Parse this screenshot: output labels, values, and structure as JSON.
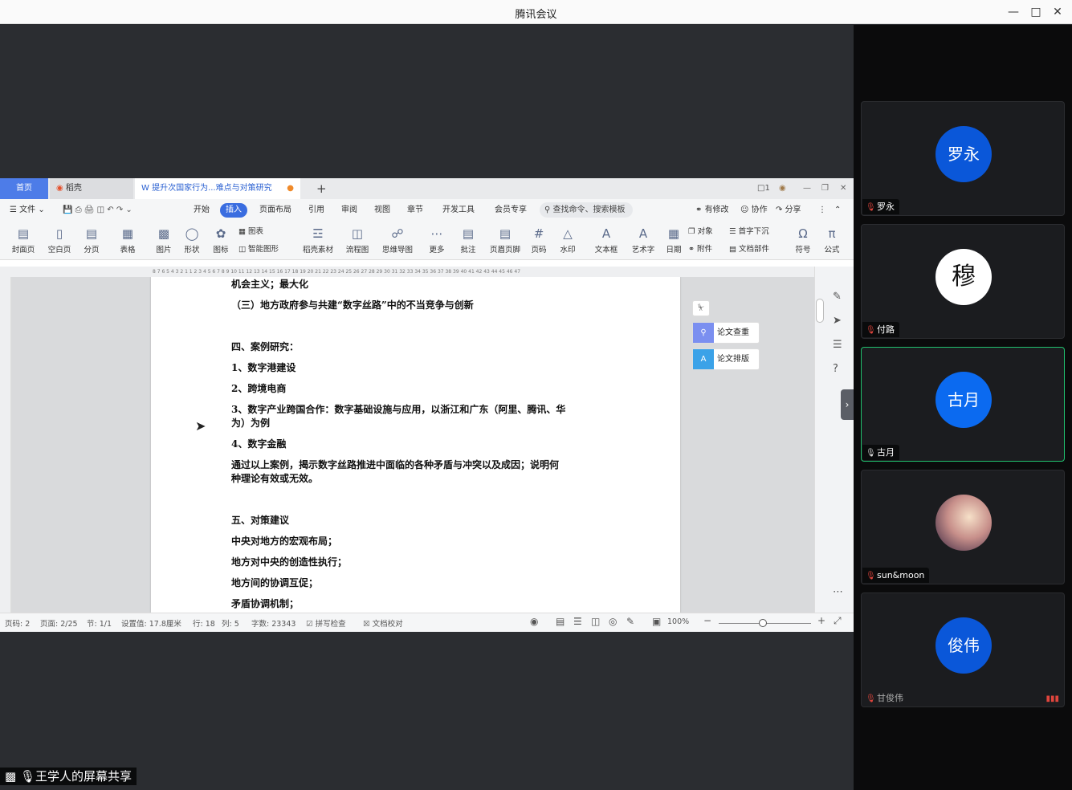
{
  "window": {
    "title": "腾讯会议"
  },
  "participants": [
    {
      "name": "罗永",
      "avatar_text": "罗永",
      "mic": "muted",
      "active": false
    },
    {
      "name": "付路",
      "avatar_text": "",
      "mic": "muted",
      "active": false
    },
    {
      "name": "古月",
      "avatar_text": "古月",
      "mic": "on",
      "active": true
    },
    {
      "name": "sun&moon",
      "avatar_text": "",
      "mic": "muted",
      "active": false
    },
    {
      "name": "甘俊伟",
      "avatar_text": "俊伟",
      "mic": "muted",
      "active": false
    }
  ],
  "share_label": "王学人的屏幕共享",
  "wps": {
    "tabs": {
      "home": "首页",
      "daoke": "稻壳",
      "doc": "提升次国家行为...难点与对策研究"
    },
    "menus": [
      "开始",
      "插入",
      "页面布局",
      "引用",
      "审阅",
      "视图",
      "章节",
      "开发工具",
      "会员专享"
    ],
    "file_menu": "文件",
    "search_placeholder": "查找命令、搜索模板",
    "right_actions": [
      "有修改",
      "协作",
      "分享"
    ],
    "ribbon": {
      "big": [
        "封面页",
        "空白页",
        "分页",
        "表格",
        "图片",
        "形状",
        "图标",
        "稻壳素材",
        "流程图",
        "思维导图",
        "更多",
        "批注",
        "页眉页脚",
        "页码",
        "水印",
        "文本框",
        "艺术字",
        "日期",
        "符号",
        "公式"
      ],
      "small": [
        "图表",
        "智能图形",
        "对象",
        "附件",
        "首字下沉",
        "文档部件"
      ]
    },
    "ruler_numbers": "8 7 6 5 4 3 2 1   1 2 3 4 5 6 7 8 9 10 11 12 13 14 15 16 17 18 19 20 21 22 23 24 25 26 27 28 29 30 31 32 33 34 35 36 37 38 39 40 41 42 43 44 45 46 47",
    "doc_lines": [
      "机会主义；最大化",
      "（三）地方政府参与共建“数字丝路”中的不当竞争与创新",
      "四、案例研究：",
      "1、数字港建设",
      "2、跨境电商",
      "3、数字产业跨国合作：数字基础设施与应用，以浙江和广东（阿里、腾讯、华",
      "为）为例",
      "4、数字金融",
      "通过以上案例，揭示数字丝路推进中面临的各种矛盾与冲突以及成因；说明何",
      "种理论有效或无效。",
      "五、对策建议",
      "中央对地方的宏观布局；",
      "地方对中央的创造性执行；",
      "地方间的协调互促；",
      "矛盾协调机制；"
    ],
    "float_buttons": [
      "论文查重",
      "论文排版"
    ],
    "status": {
      "page_code": "页码: 2",
      "page": "页面: 2/25",
      "section": "节: 1/1",
      "setting": "设置值: 17.8厘米",
      "row": "行: 18",
      "col": "列: 5",
      "words": "字数: 23343",
      "spell": "拼写检查",
      "proof": "文档校对",
      "zoom": "100%"
    }
  }
}
